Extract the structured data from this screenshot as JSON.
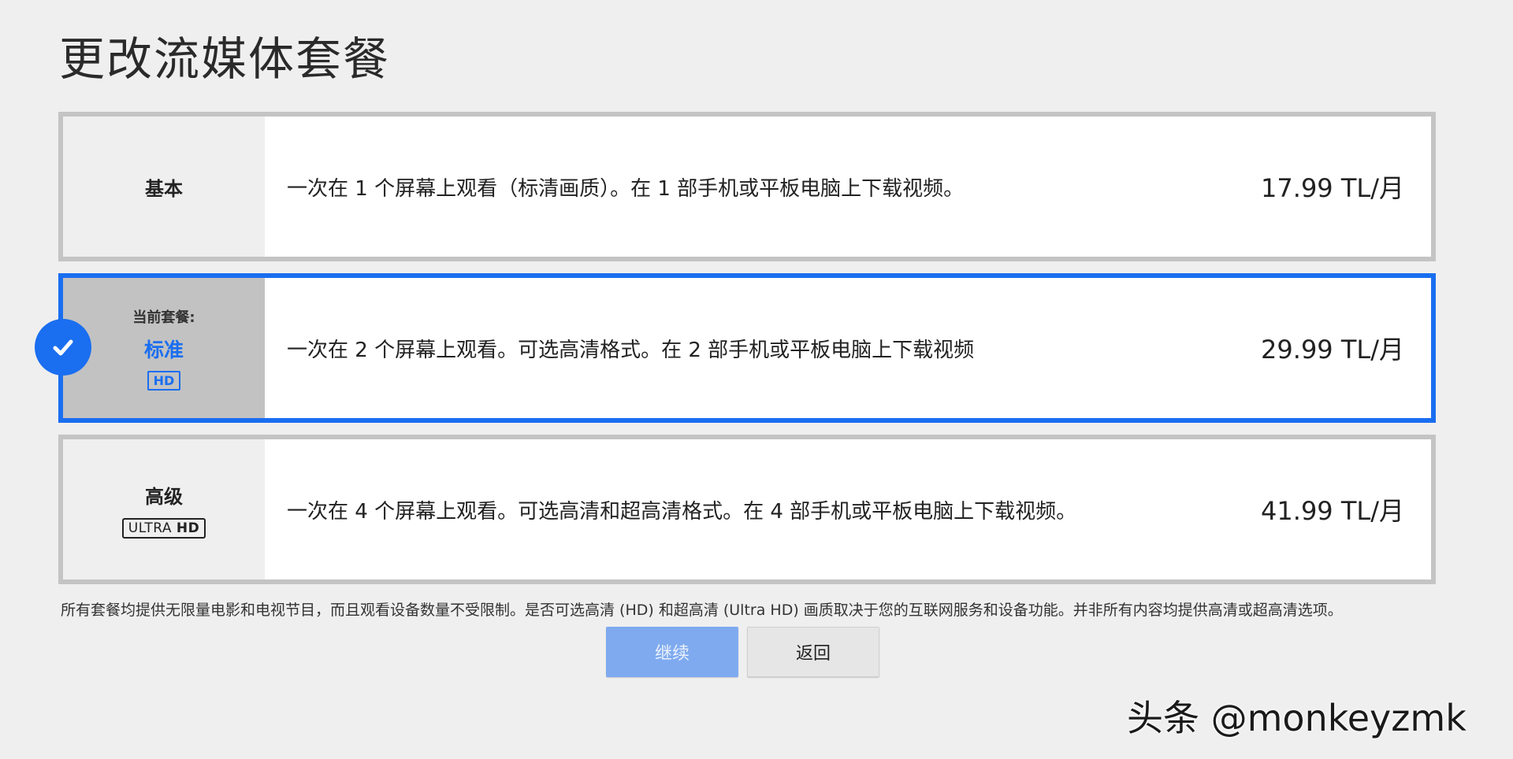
{
  "page": {
    "title": "更改流媒体套餐"
  },
  "plans": [
    {
      "name": "基本",
      "description": "一次在 1 个屏幕上观看（标清画质）。在 1 部手机或平板电脑上下载视频。",
      "price": "17.99 TL/月",
      "selected": false
    },
    {
      "current_label": "当前套餐:",
      "name": "标准",
      "badge": "HD",
      "description": "一次在 2 个屏幕上观看。可选高清格式。在 2 部手机或平板电脑上下载视频",
      "price": "29.99 TL/月",
      "selected": true
    },
    {
      "name": "高级",
      "badge_light": "ULTRA",
      "badge_bold": "HD",
      "description": "一次在 4 个屏幕上观看。可选高清和超高清格式。在 4 部手机或平板电脑上下载视频。",
      "price": "41.99 TL/月",
      "selected": false
    }
  ],
  "footnote": "所有套餐均提供无限量电影和电视节目，而且观看设备数量不受限制。是否可选高清 (HD) 和超高清 (Ultra HD) 画质取决于您的互联网服务和设备功能。并非所有内容均提供高清或超高清选项。",
  "buttons": {
    "continue_label": "继续",
    "back_label": "返回"
  },
  "watermark": "头条 @monkeyzmk",
  "colors": {
    "accent": "#1a6ef0",
    "continue_bg": "#7faaef",
    "border": "#c4c4c4",
    "background": "#efefef"
  },
  "icons": {
    "selected_indicator": "check-icon"
  }
}
